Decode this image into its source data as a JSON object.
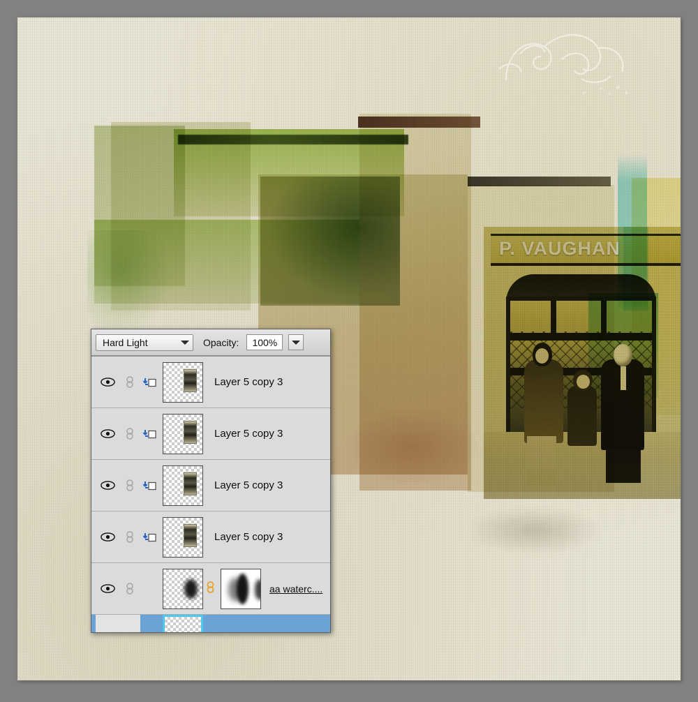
{
  "document": {
    "canvas_background_color": "#e9e5d5",
    "workspace_background_color": "#818181",
    "artwork_title": "Mixed-media collage with vintage shopfront photograph",
    "sign_text": "P. VAUGHAN"
  },
  "layers_panel": {
    "blend_mode": {
      "label": "Hard Light",
      "arrow_icon": "chevron-down-icon"
    },
    "opacity": {
      "label": "Opacity:",
      "value": "100%",
      "arrow_icon": "chevron-down-icon"
    },
    "rows": [
      {
        "name": "Layer 5 copy 3",
        "visible": true,
        "eye_icon": "eye-icon",
        "link_icon": "link-chain-icon",
        "clipping_icon": "clipping-mask-arrow-icon",
        "thumbnail": "transparent-thumbnail-with-photo",
        "selected": false
      },
      {
        "name": "Layer 5 copy 3",
        "visible": true,
        "eye_icon": "eye-icon",
        "link_icon": "link-chain-icon",
        "clipping_icon": "clipping-mask-arrow-icon",
        "thumbnail": "transparent-thumbnail-with-photo",
        "selected": false
      },
      {
        "name": "Layer 5 copy 3",
        "visible": true,
        "eye_icon": "eye-icon",
        "link_icon": "link-chain-icon",
        "clipping_icon": "clipping-mask-arrow-icon",
        "thumbnail": "transparent-thumbnail-with-photo",
        "selected": false
      },
      {
        "name": "Layer 5 copy 3",
        "visible": true,
        "eye_icon": "eye-icon",
        "link_icon": "link-chain-icon",
        "clipping_icon": "clipping-mask-arrow-icon",
        "thumbnail": "transparent-thumbnail-with-photo",
        "selected": false
      },
      {
        "name": "aa waterc....",
        "visible": true,
        "eye_icon": "eye-icon",
        "link_icon": "link-chain-icon",
        "mask_link_icon": "mask-link-icon",
        "thumbnail": "transparent-thumbnail-with-blob",
        "mask_thumbnail": "layer-mask-thumbnail",
        "selected": false
      },
      {
        "name": "",
        "visible": false,
        "thumbnail": "transparent-thumbnail",
        "selected": true
      }
    ],
    "colors": {
      "panel_background": "#d4d4d4",
      "row_background": "#d9dbdd",
      "selected_row": "#6ba3d6",
      "selection_outline": "#4ec8e8",
      "clipping_arrow": "#2a62c4",
      "mask_link": "#e8a324"
    }
  }
}
